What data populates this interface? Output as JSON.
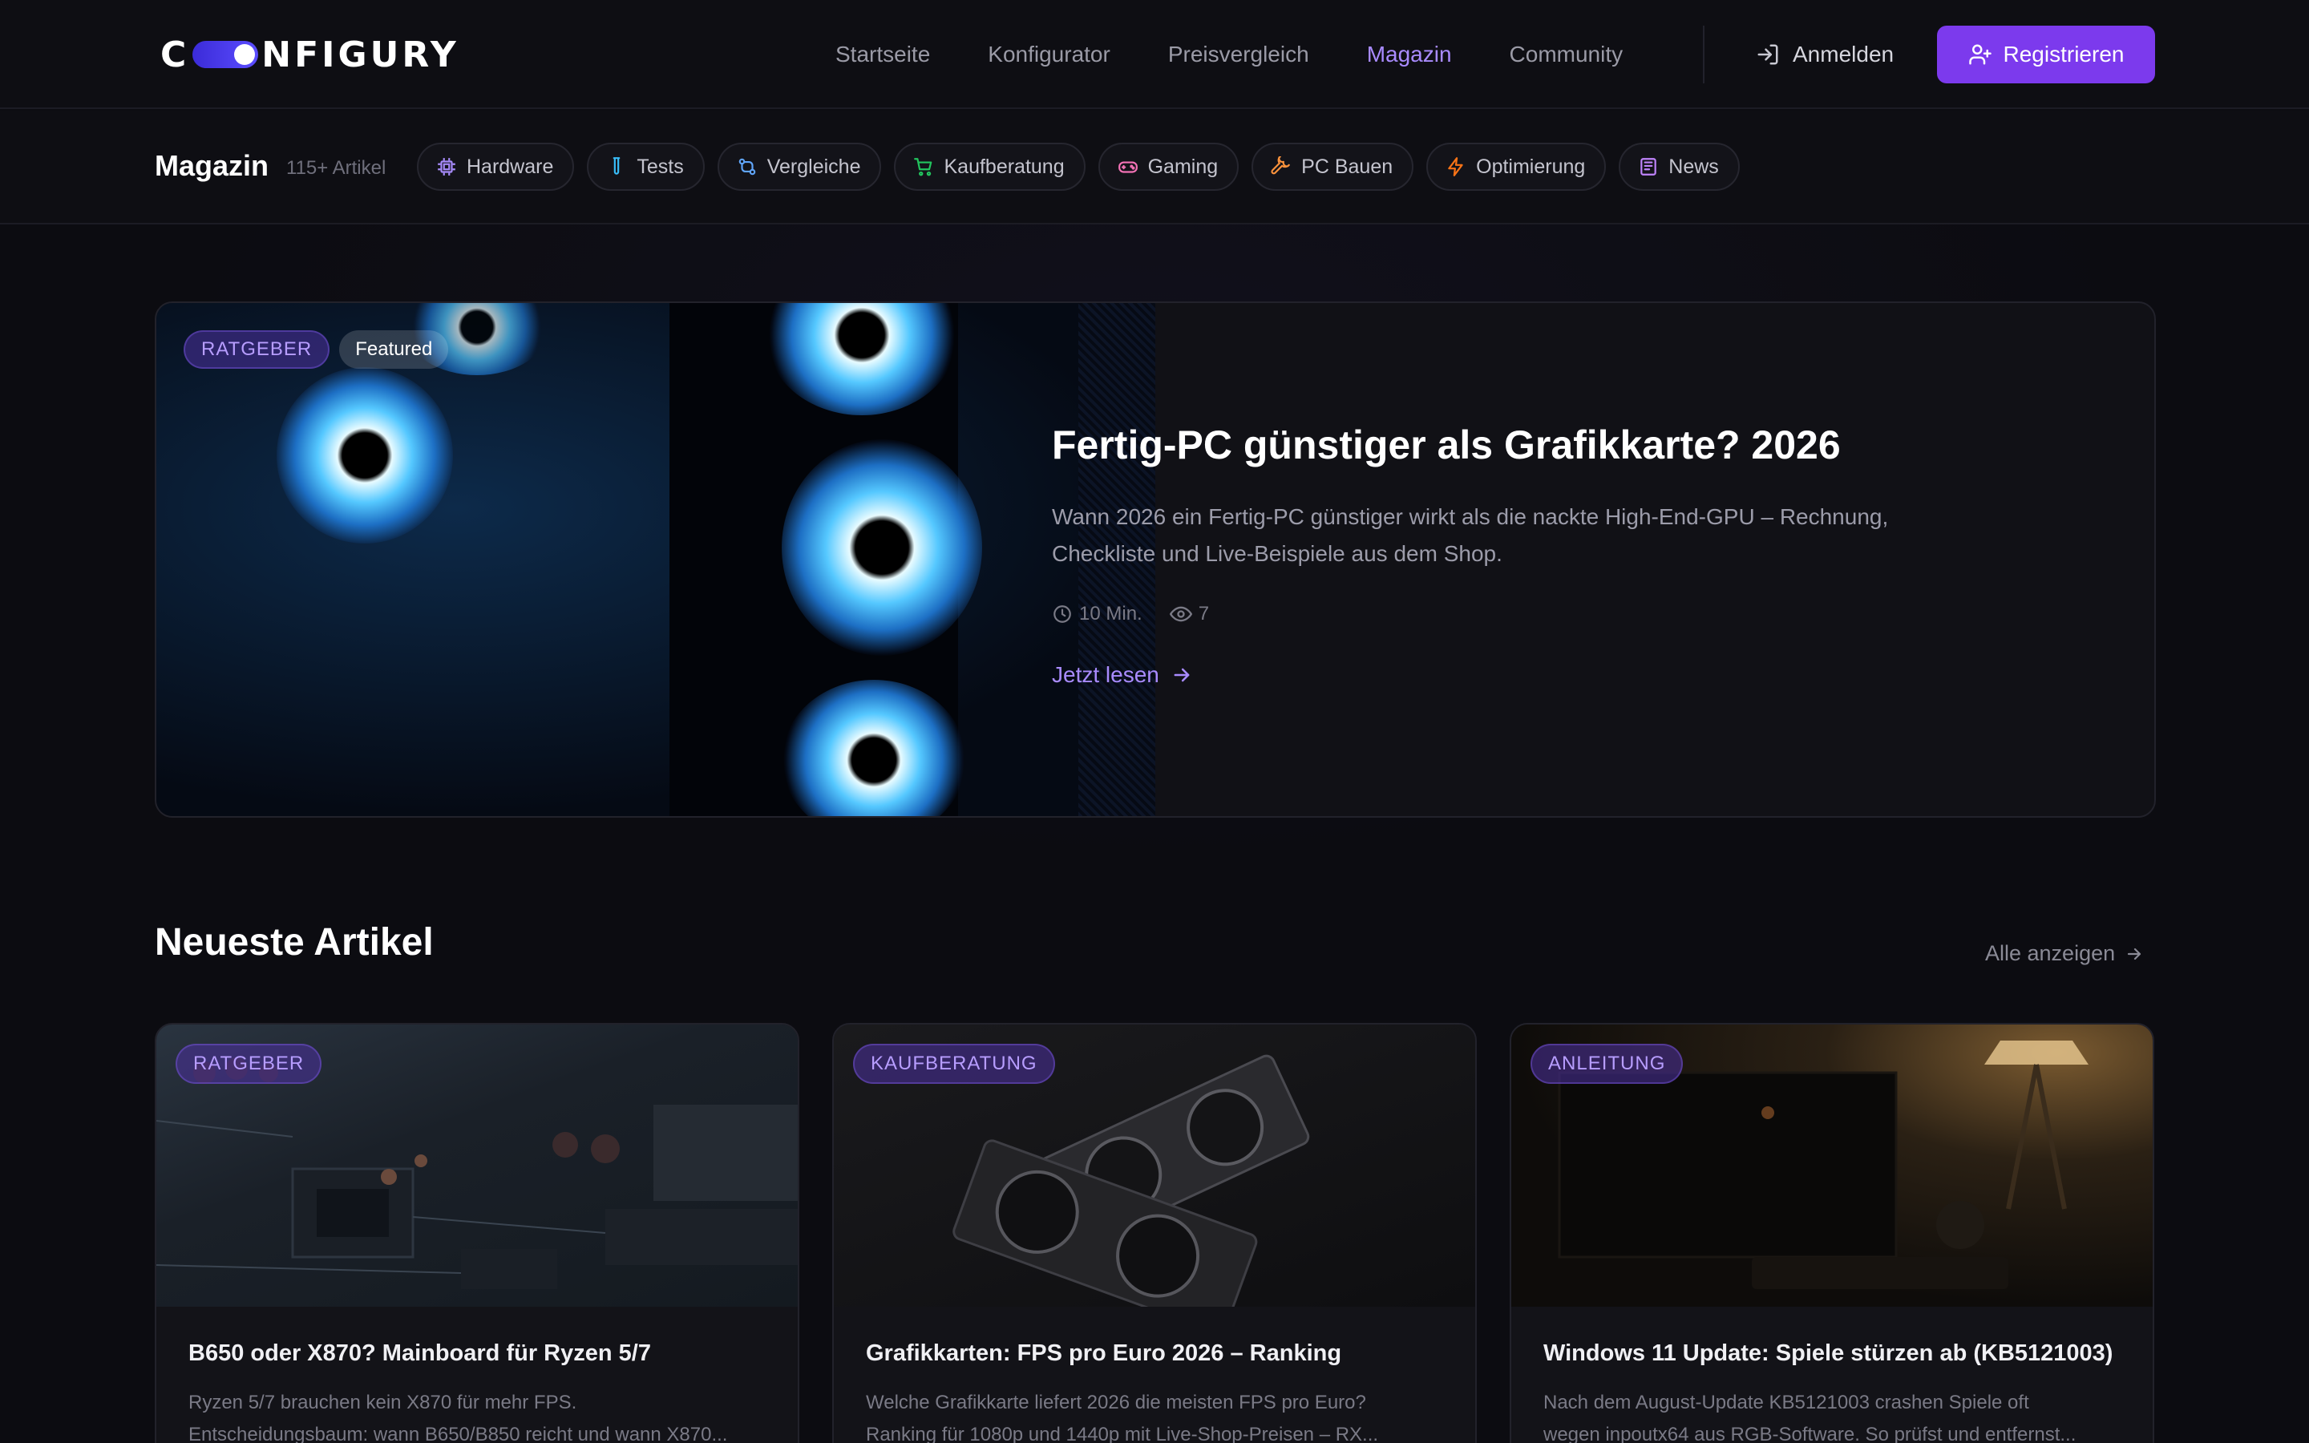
{
  "brand": {
    "logo_prefix": "C",
    "logo_suffix": "NFIGURY"
  },
  "nav": {
    "links": [
      "Startseite",
      "Konfigurator",
      "Preisvergleich",
      "Magazin",
      "Community"
    ],
    "active": "Magazin",
    "login": "Anmelden",
    "register": "Registrieren"
  },
  "magazine": {
    "title": "Magazin",
    "count": "115+ Artikel",
    "categories": [
      {
        "label": "Hardware",
        "icon": "chip-icon",
        "color": "#a78bfa"
      },
      {
        "label": "Tests",
        "icon": "test-tube-icon",
        "color": "#38bdf8"
      },
      {
        "label": "Vergleiche",
        "icon": "compare-icon",
        "color": "#60a5fa"
      },
      {
        "label": "Kaufberatung",
        "icon": "cart-icon",
        "color": "#22c55e"
      },
      {
        "label": "Gaming",
        "icon": "gamepad-icon",
        "color": "#f472b6"
      },
      {
        "label": "PC Bauen",
        "icon": "wrench-icon",
        "color": "#fb923c"
      },
      {
        "label": "Optimierung",
        "icon": "lightning-icon",
        "color": "#f97316"
      },
      {
        "label": "News",
        "icon": "newspaper-icon",
        "color": "#c084fc"
      }
    ]
  },
  "featured": {
    "category": "RATGEBER",
    "badge": "Featured",
    "title": "Fertig-PC günstiger als Grafikkarte? 2026",
    "excerpt": "Wann 2026 ein Fertig-PC günstiger wirkt als die nackte High-End-GPU – Rechnung, Checkliste und Live-Beispiele aus dem Shop.",
    "read_time": "10 Min.",
    "views": "7",
    "cta": "Jetzt lesen"
  },
  "latest": {
    "title": "Neueste Artikel",
    "see_all": "Alle anzeigen",
    "articles": [
      {
        "category": "RATGEBER",
        "title": "B650 oder X870? Mainboard für Ryzen 5/7",
        "excerpt_line1": "Ryzen 5/7 brauchen kein X870 für mehr FPS.",
        "excerpt_line2": "Entscheidungsbaum: wann B650/B850 reicht und wann X870..."
      },
      {
        "category": "KAUFBERATUNG",
        "title": "Grafikkarten: FPS pro Euro 2026 – Ranking",
        "excerpt_line1": "Welche Grafikkarte liefert 2026 die meisten FPS pro Euro?",
        "excerpt_line2": "Ranking für 1080p und 1440p mit Live-Shop-Preisen – RX..."
      },
      {
        "category": "ANLEITUNG",
        "title": "Windows 11 Update: Spiele stürzen ab (KB5121003)",
        "excerpt_line1": "Nach dem August-Update KB5121003 crashen Spiele oft",
        "excerpt_line2": "wegen inpoutx64 aus RGB-Software. So prüfst und entfernst..."
      }
    ]
  },
  "colors": {
    "accent": "#7c3aed",
    "accent_text": "#a98bff",
    "background": "#0c0c11"
  }
}
